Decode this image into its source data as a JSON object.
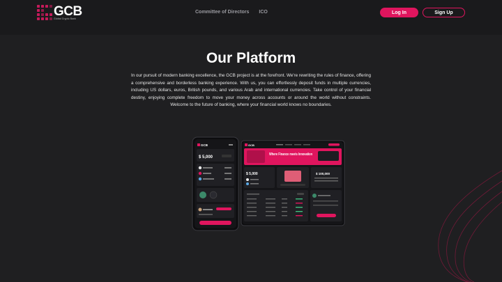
{
  "brand": {
    "name": "GCB",
    "tagline": "Global Crypto Bank",
    "accent": "#e0155e",
    "background": "#1f1f21"
  },
  "nav": {
    "links": [
      "Committee of Directors",
      "ICO"
    ],
    "login_label": "Log In",
    "signup_label": "Sign Up"
  },
  "hero": {
    "title": "Our Platform",
    "description": "In our pursuit of modern banking excellence, the GCB project is at the forefront. We're rewriting the rules of finance, offering a comprehensive and borderless banking experience. With us, you can effortlessly deposit funds in multiple currencies, including US dollars, euros, British pounds, and various Arab and international currencies. Take control of your financial destiny, enjoying complete freedom to move your money across accounts or around the world without constraints. Welcome to the future of banking, where your financial world knows no boundaries."
  },
  "mockup": {
    "phone_brand": "GCB",
    "phone_balance": "$ 5,000",
    "desktop_brand": "GCB",
    "banner_text": "Where Finance meets Innovation",
    "desktop_balance": "$ 5,000",
    "desktop_total": "$ 100,000",
    "cta_label": "Transfer Money"
  }
}
